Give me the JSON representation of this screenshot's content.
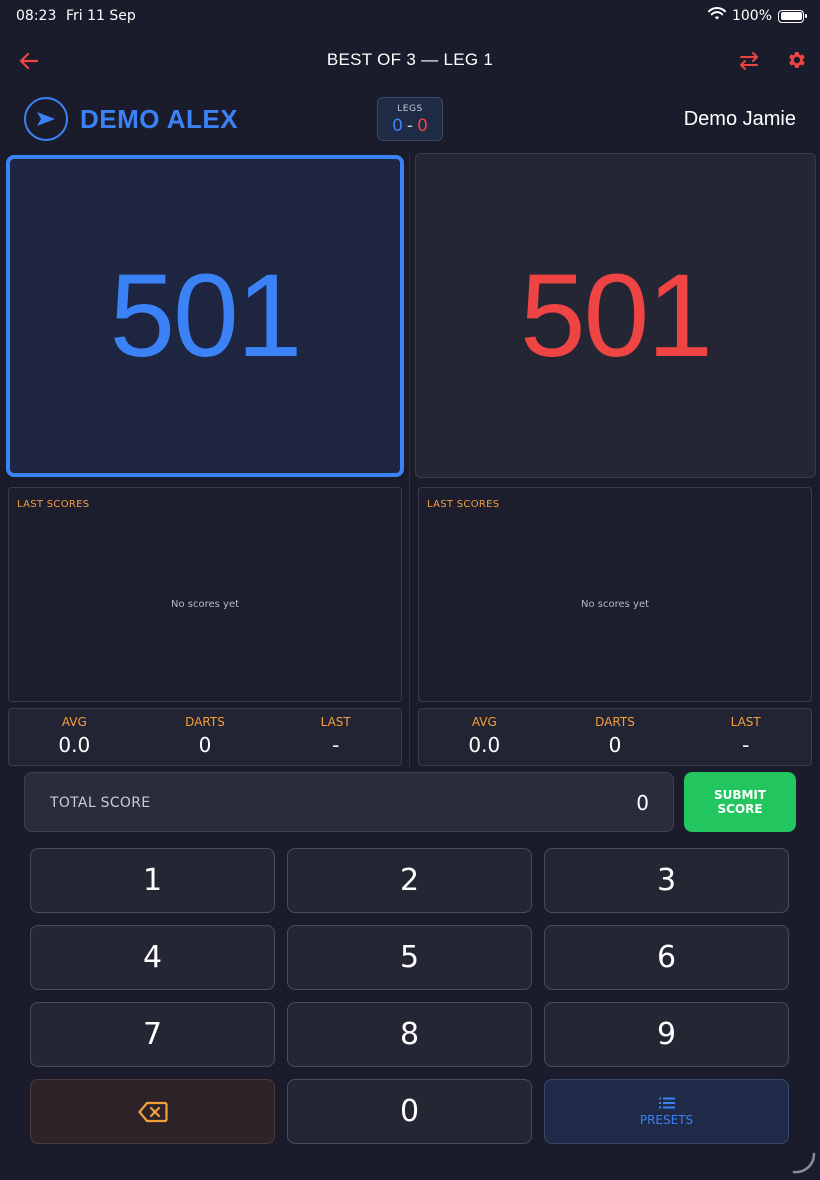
{
  "status_bar": {
    "time": "08:23",
    "date": "Fri 11 Sep",
    "battery": "100%"
  },
  "header": {
    "title": "BEST OF 3 — LEG 1"
  },
  "players": {
    "p1": {
      "name": "DEMO ALEX",
      "score": "501",
      "color": "#3b82f6"
    },
    "p2": {
      "name": "Demo Jamie",
      "score": "501",
      "color": "#ef4444"
    }
  },
  "legs": {
    "label": "LEGS",
    "p1": "0",
    "separator": "-",
    "p2": "0"
  },
  "last_scores": {
    "label": "LAST SCORES",
    "empty_text": "No scores yet"
  },
  "stats": {
    "p1": [
      {
        "label": "AVG",
        "value": "0.0"
      },
      {
        "label": "DARTS",
        "value": "0"
      },
      {
        "label": "LAST",
        "value": "-"
      }
    ],
    "p2": [
      {
        "label": "AVG",
        "value": "0.0"
      },
      {
        "label": "DARTS",
        "value": "0"
      },
      {
        "label": "LAST",
        "value": "-"
      }
    ]
  },
  "input": {
    "total_label": "TOTAL SCORE",
    "total_value": "0",
    "submit_label": "SUBMIT SCORE"
  },
  "keypad": {
    "keys": [
      "1",
      "2",
      "3",
      "4",
      "5",
      "6",
      "7",
      "8",
      "9"
    ],
    "zero": "0",
    "presets_label": "PRESETS",
    "backspace_icon": "backspace-icon"
  },
  "colors": {
    "accent": "#3b82f6",
    "opponent": "#ef4444",
    "label": "#f59e3c",
    "submit": "#22c55e",
    "background": "#1b1c2b"
  }
}
